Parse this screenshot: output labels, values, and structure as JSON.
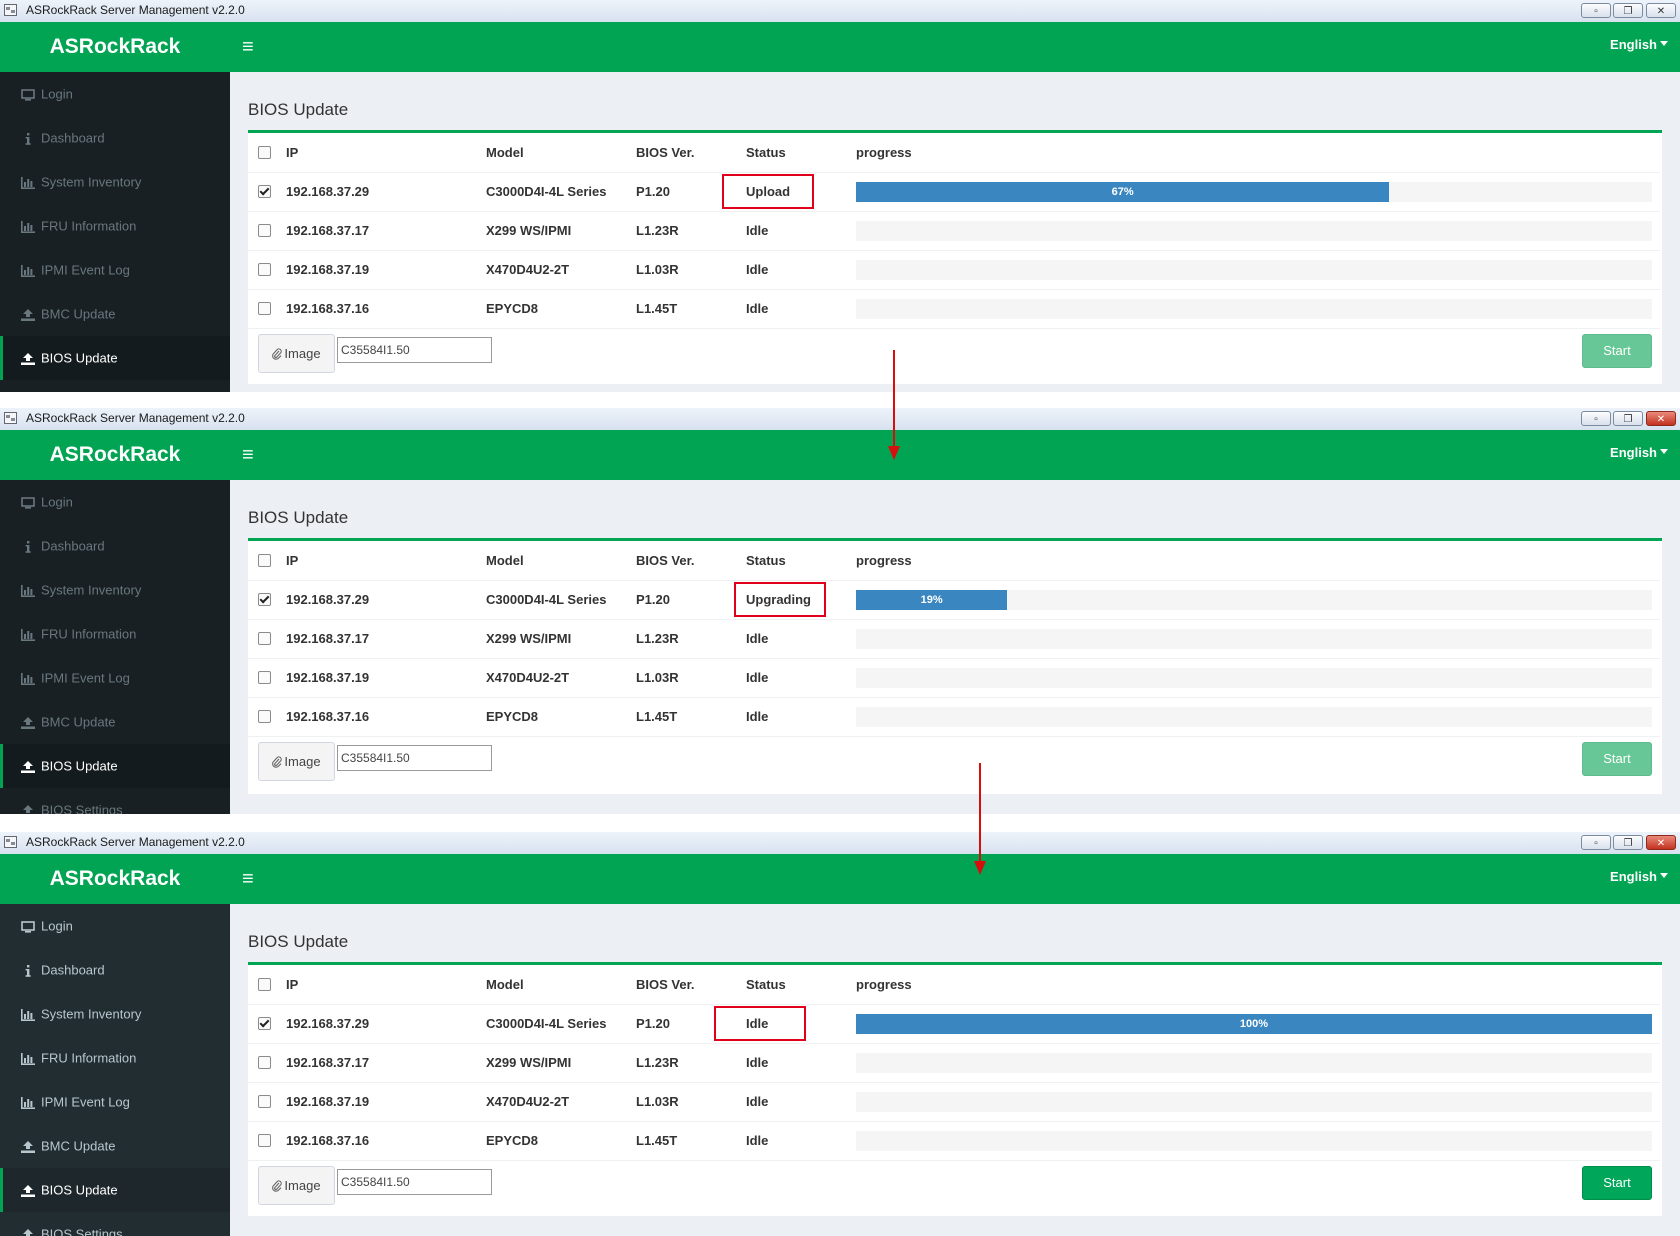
{
  "window": {
    "title": "ASRockRack Server Management v2.2.0"
  },
  "header": {
    "brand": "ASRockRack",
    "language": "English"
  },
  "sidebar": {
    "items": [
      {
        "label": "Login",
        "icon": "monitor-icon"
      },
      {
        "label": "Dashboard",
        "icon": "info-icon"
      },
      {
        "label": "System Inventory",
        "icon": "bar-chart-icon"
      },
      {
        "label": "FRU Information",
        "icon": "bar-chart-icon"
      },
      {
        "label": "IPMI Event Log",
        "icon": "bar-chart-icon"
      },
      {
        "label": "BMC Update",
        "icon": "upload-icon"
      },
      {
        "label": "BIOS Update",
        "icon": "upload-icon"
      },
      {
        "label": "BIOS Settings",
        "icon": "upload-icon"
      }
    ]
  },
  "page": {
    "title": "BIOS Update",
    "columns": {
      "ip": "IP",
      "model": "Model",
      "bios": "BIOS Ver.",
      "status": "Status",
      "progress": "progress"
    },
    "image_button": "Image",
    "start_button": "Start",
    "image_file": "C35584I1.50"
  },
  "steps": [
    {
      "highlight_status": "Upload",
      "start_enabled": false,
      "rows": [
        {
          "checked": true,
          "ip": "192.168.37.29",
          "model": "C3000D4I-4L Series",
          "bios": "P1.20",
          "status": "Upload",
          "progress": 67,
          "progress_label": "67%"
        },
        {
          "checked": false,
          "ip": "192.168.37.17",
          "model": "X299 WS/IPMI",
          "bios": "L1.23R",
          "status": "Idle",
          "progress": 0,
          "progress_label": ""
        },
        {
          "checked": false,
          "ip": "192.168.37.19",
          "model": "X470D4U2-2T",
          "bios": "L1.03R",
          "status": "Idle",
          "progress": 0,
          "progress_label": ""
        },
        {
          "checked": false,
          "ip": "192.168.37.16",
          "model": "EPYCD8",
          "bios": "L1.45T",
          "status": "Idle",
          "progress": 0,
          "progress_label": ""
        }
      ]
    },
    {
      "highlight_status": "Upgrading",
      "start_enabled": false,
      "rows": [
        {
          "checked": true,
          "ip": "192.168.37.29",
          "model": "C3000D4I-4L Series",
          "bios": "P1.20",
          "status": "Upgrading",
          "progress": 19,
          "progress_label": "19%"
        },
        {
          "checked": false,
          "ip": "192.168.37.17",
          "model": "X299 WS/IPMI",
          "bios": "L1.23R",
          "status": "Idle",
          "progress": 0,
          "progress_label": ""
        },
        {
          "checked": false,
          "ip": "192.168.37.19",
          "model": "X470D4U2-2T",
          "bios": "L1.03R",
          "status": "Idle",
          "progress": 0,
          "progress_label": ""
        },
        {
          "checked": false,
          "ip": "192.168.37.16",
          "model": "EPYCD8",
          "bios": "L1.45T",
          "status": "Idle",
          "progress": 0,
          "progress_label": ""
        }
      ]
    },
    {
      "highlight_status": "Idle",
      "start_enabled": true,
      "rows": [
        {
          "checked": true,
          "ip": "192.168.37.29",
          "model": "C3000D4I-4L Series",
          "bios": "P1.20",
          "status": "Idle",
          "progress": 100,
          "progress_label": "100%"
        },
        {
          "checked": false,
          "ip": "192.168.37.17",
          "model": "X299 WS/IPMI",
          "bios": "L1.23R",
          "status": "Idle",
          "progress": 0,
          "progress_label": ""
        },
        {
          "checked": false,
          "ip": "192.168.37.19",
          "model": "X470D4U2-2T",
          "bios": "L1.03R",
          "status": "Idle",
          "progress": 0,
          "progress_label": ""
        },
        {
          "checked": false,
          "ip": "192.168.37.16",
          "model": "EPYCD8",
          "bios": "L1.45T",
          "status": "Idle",
          "progress": 0,
          "progress_label": ""
        }
      ]
    }
  ],
  "colors": {
    "header_green": "#00a452",
    "sidebar_dark": "#222d32",
    "progress_blue": "#3a86c0",
    "highlight_red": "#e0001b",
    "arrow_red": "#d70e0e"
  }
}
